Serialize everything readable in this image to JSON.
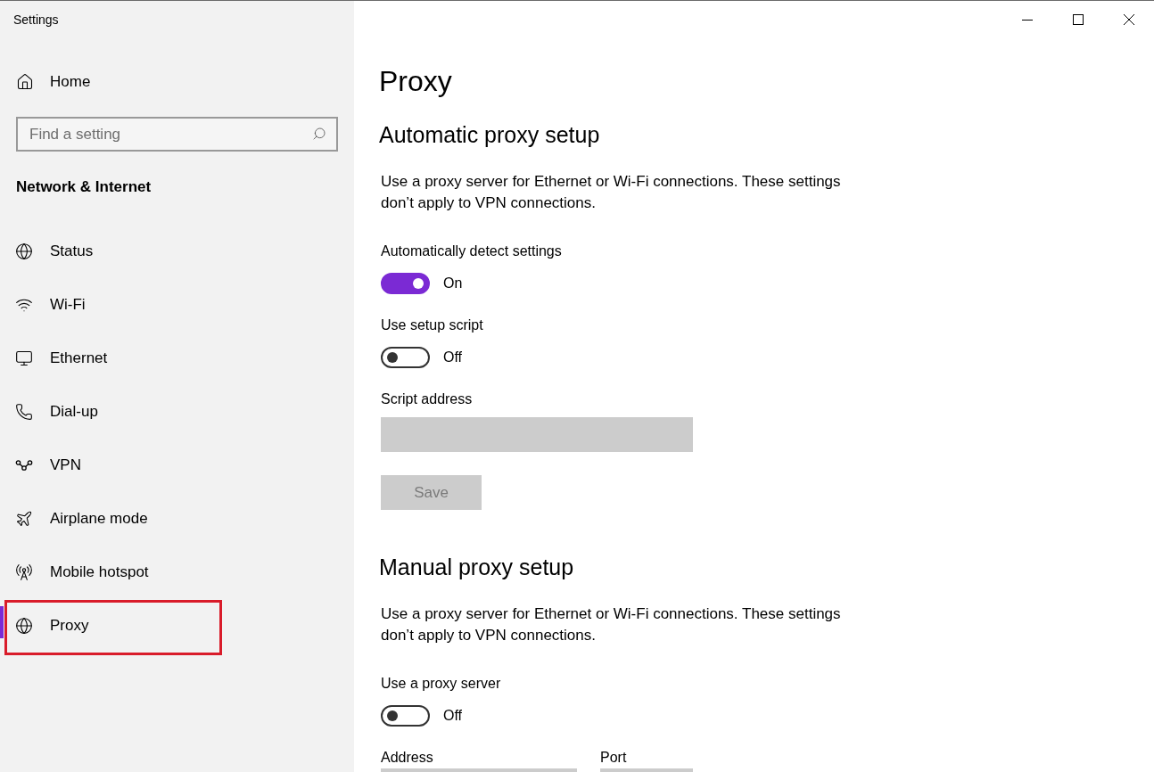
{
  "window": {
    "title": "Settings"
  },
  "sidebar": {
    "home": {
      "label": "Home"
    },
    "search": {
      "placeholder": "Find a setting"
    },
    "section_title": "Network & Internet",
    "items": [
      {
        "label": "Status",
        "selected": false,
        "highlighted": false
      },
      {
        "label": "Wi-Fi",
        "selected": false,
        "highlighted": false
      },
      {
        "label": "Ethernet",
        "selected": false,
        "highlighted": false
      },
      {
        "label": "Dial-up",
        "selected": false,
        "highlighted": false
      },
      {
        "label": "VPN",
        "selected": false,
        "highlighted": false
      },
      {
        "label": "Airplane mode",
        "selected": false,
        "highlighted": false
      },
      {
        "label": "Mobile hotspot",
        "selected": false,
        "highlighted": false
      },
      {
        "label": "Proxy",
        "selected": true,
        "highlighted": true
      }
    ]
  },
  "page": {
    "title": "Proxy",
    "sections": [
      {
        "heading": "Automatic proxy setup",
        "description": "Use a proxy server for Ethernet or Wi-Fi connections. These settings don’t apply to VPN connections.",
        "settings": [
          {
            "kind": "toggle",
            "label": "Automatically detect settings",
            "on": true,
            "state_text": "On"
          },
          {
            "kind": "toggle",
            "label": "Use setup script",
            "on": false,
            "state_text": "Off"
          },
          {
            "kind": "text_field",
            "label": "Script address",
            "disabled": true
          },
          {
            "kind": "button",
            "label": "Save",
            "disabled": true
          }
        ]
      },
      {
        "heading": "Manual proxy setup",
        "description": "Use a proxy server for Ethernet or Wi-Fi connections. These settings don’t apply to VPN connections.",
        "settings": [
          {
            "kind": "toggle",
            "label": "Use a proxy server",
            "on": false,
            "state_text": "Off"
          },
          {
            "kind": "field_row",
            "fields": [
              {
                "label": "Address",
                "disabled": true
              },
              {
                "label": "Port",
                "disabled": true
              }
            ]
          }
        ]
      }
    ]
  }
}
